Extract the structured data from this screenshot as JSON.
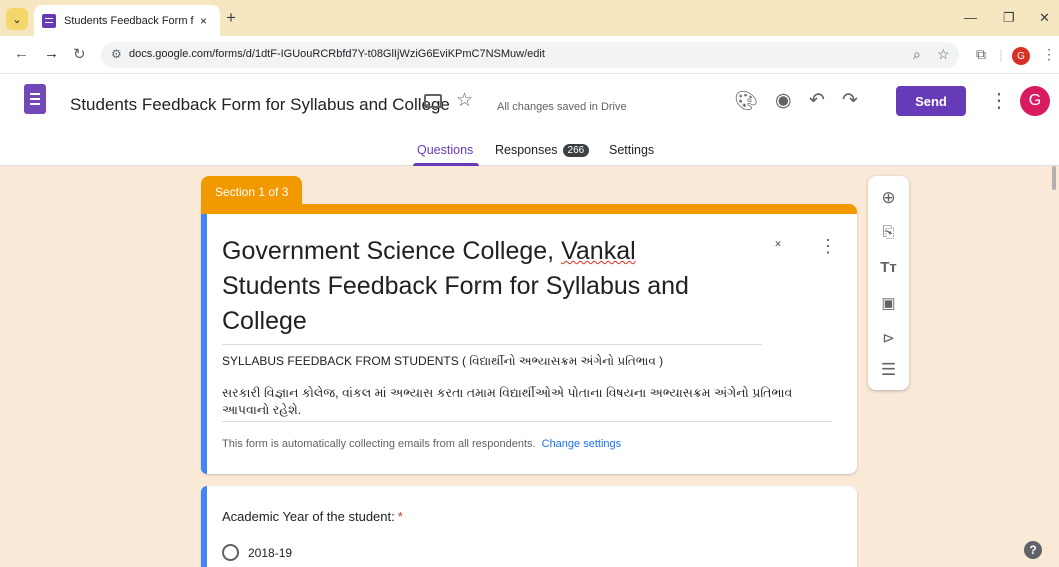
{
  "browser": {
    "tab_title": "Students Feedback Form for Sylla",
    "tab_close": "×",
    "new_tab": "+",
    "url": "docs.google.com/forms/d/1dtF-IGUouRCRbfd7Y-t08GlIjWziG6EviKPmC7NSMuw/edit",
    "profile_initial": "G"
  },
  "header": {
    "doc_title": "Students Feedback Form for Syllabus and College",
    "save_status": "All changes saved in Drive",
    "send_label": "Send",
    "avatar_initial": "G",
    "tabs": {
      "questions": "Questions",
      "responses": "Responses",
      "responses_count": "266",
      "settings": "Settings"
    }
  },
  "form": {
    "section_label": "Section 1 of 3",
    "title_line1_a": "Government Science College, ",
    "title_line1_b": "Vankal",
    "title_rest": "Students Feedback Form for Syllabus and College",
    "subtitle": "SYLLABUS FEEDBACK FROM STUDENTS ( વિદ્યાર્થીનો અભ્યાસક્રમ અંગેનો પ્રતિભાવ )",
    "description": "સરકારી વિજ્ઞાન કોલેજ, વાંકલ માં અભ્યાસ કરતા તમામ વિદ્યાર્થીઓએ પોતાના વિષયના અભ્યાસક્રમ અંગેનો પ્રતિભાવ આપવાનો રહેશે.",
    "email_note": "This form is automatically collecting emails from all respondents.",
    "change_settings": "Change settings"
  },
  "question": {
    "title": "Academic Year of the student:",
    "required_mark": "*",
    "option1": "2018-19"
  },
  "icons": {
    "palette": "palette-icon",
    "preview": "eye-icon",
    "undo": "undo-icon",
    "redo": "redo-icon"
  },
  "colors": {
    "accent": "#673ab7",
    "section": "#f29900",
    "background": "#fbe9d7",
    "left_bar": "#4285f4"
  }
}
